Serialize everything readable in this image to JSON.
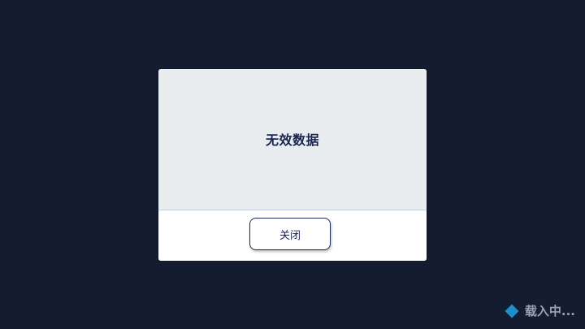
{
  "dialog": {
    "message": "无效数据",
    "close_label": "关闭"
  },
  "loading": {
    "label": "载入中...",
    "icon": "diamond-icon"
  },
  "colors": {
    "background": "#141d30",
    "dialog_body": "#e9edf0",
    "text": "#1a2550",
    "accent": "#1d8fc9",
    "loading_text": "#9aa3ae"
  }
}
